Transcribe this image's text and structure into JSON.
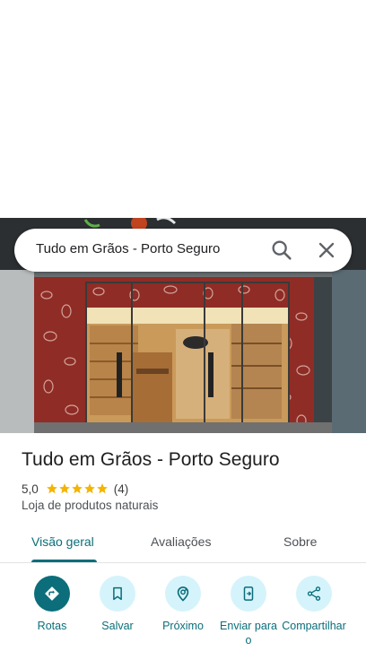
{
  "search": {
    "query": "Tudo em Grãos - Porto Seguro",
    "search_icon": "search-icon",
    "close_icon": "close-icon"
  },
  "place": {
    "title": "Tudo em Grãos - Porto Seguro",
    "rating": "5,0",
    "stars_filled": 5,
    "review_count": "(4)",
    "category": "Loja de produtos naturais"
  },
  "tabs": [
    {
      "label": "Visão geral",
      "active": true
    },
    {
      "label": "Avaliações",
      "active": false
    },
    {
      "label": "Sobre",
      "active": false
    }
  ],
  "actions": [
    {
      "label": "Rotas",
      "icon": "directions-icon"
    },
    {
      "label": "Salvar",
      "icon": "bookmark-icon"
    },
    {
      "label": "Próximo",
      "icon": "nearby-icon"
    },
    {
      "label": "Enviar para o",
      "icon": "send-to-phone-icon"
    },
    {
      "label": "Compartilhar",
      "icon": "share-icon"
    }
  ],
  "colors": {
    "accent": "#0b6e7a",
    "action_bg": "#d5f3fb",
    "star": "#f4b400"
  }
}
